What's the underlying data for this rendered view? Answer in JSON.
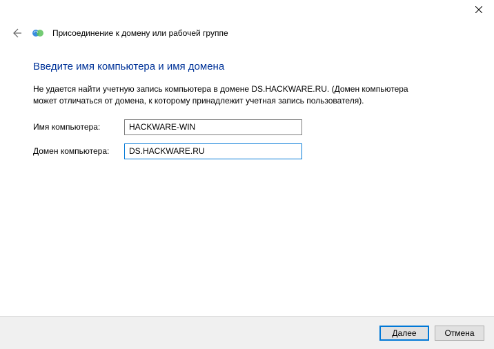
{
  "titlebar": {
    "close": "✕"
  },
  "header": {
    "title": "Присоединение к домену или рабочей группе"
  },
  "main": {
    "heading": "Введите имя компьютера и имя домена",
    "description": "Не удается найти учетную запись компьютера в домене DS.HACKWARE.RU. (Домен компьютера может отличаться от домена, к которому принадлежит учетная запись пользователя).",
    "fields": {
      "computer_name": {
        "label": "Имя компьютера:",
        "value": "HACKWARE-WIN"
      },
      "computer_domain": {
        "label": "Домен компьютера:",
        "value": "DS.HACKWARE.RU"
      }
    }
  },
  "footer": {
    "next": "Далее",
    "cancel": "Отмена"
  }
}
